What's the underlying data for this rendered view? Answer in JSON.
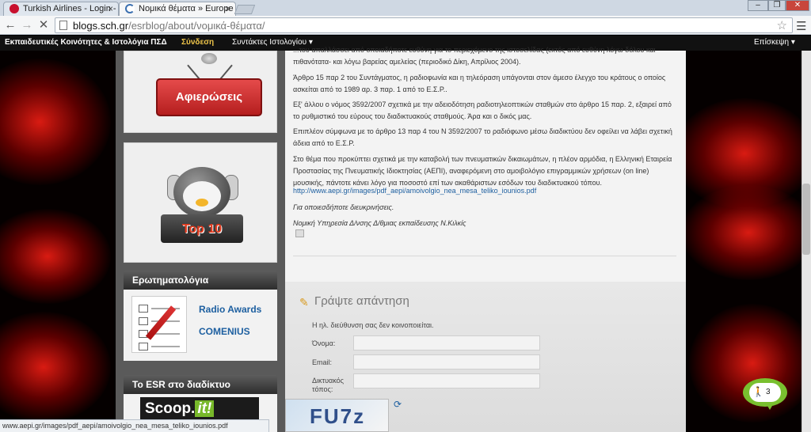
{
  "browser": {
    "tabs": [
      {
        "title": "Turkish Airlines - Login -",
        "close": "×"
      },
      {
        "title": "Νομικά θέματα » Europe",
        "close": "×"
      }
    ],
    "window_controls": {
      "minimize": "–",
      "restore": "❐",
      "close": "✕"
    },
    "nav": {
      "back": "←",
      "forward": "→",
      "stop": "✕"
    },
    "url": {
      "host": "blogs.sch.gr",
      "path": "/esrblog/about/νομικά-θέματα/"
    },
    "star": "☆",
    "menu": "☰",
    "status_url": "www.aepi.gr/images/pdf_aepi/amoivolgio_nea_mesa_teliko_iounios.pdf"
  },
  "site_bar": {
    "brand": "Εκπαιδευτικές Κοινότητες & Ιστολόγια ΠΣΔ",
    "login": "Σύνδεση",
    "authors": "Συντάκτες Ιστολογίου ▾",
    "visit": "Επίσκεψη ▾"
  },
  "sidebar": {
    "tributes_sign": "Αφιερώσεις",
    "top10_label": "Top 10",
    "quiz_title": "Ερωτηματολόγια",
    "radio_awards": "Radio Awards",
    "comenius": "COMENIUS",
    "esr_web_title": "Το ESR στο διαδίκτυο",
    "scoop_text": "Scoop.",
    "scoop_it": "it!"
  },
  "article": {
    "p0": "...του απαλλάσσει από οποιαδήποτε ευθύνη για το περιεχόμενο της ιστοσελίδας (εκτός από ευθύνη λόγω δόλου και πιθανότατα- και λόγω βαρείας αμελείας (περιοδικό Δίκη, Απρίλιος 2004).",
    "p1": "Άρθρο 15 παρ 2 του Συντάγματος, η ραδιοφωνία και η τηλεόραση υπάγονται στον άμεσο έλεγχο του κράτους ο οποίος ασκείται από το 1989 αρ. 3 παρ. 1 από το Ε.Σ.Ρ..",
    "p2": "Εξ' άλλου ο νόμος 3592/2007 σχετικά με την αδειοδότηση ραδιοτηλεοπτικών σταθμών στο άρθρο 15 παρ. 2, εξαιρεί από το ρυθμιστικό του εύρους του διαδικτυακούς σταθμούς. Άρα και ο δικός μας.",
    "p3": "Επιπλέον σύμφωνα με το άρθρο 13 παρ 4 του Ν 3592/2007 το ραδιόφωνο μέσω διαδικτύου δεν οφείλει να λάβει σχετική άδεια από το Ε.Σ.Ρ.",
    "p4": "Στο θέμα που προκύπτει σχετικά με την καταβολή των πνευματικών δικαιωμάτων, η πλέον αρμόδια, η Ελληνική Εταιρεία Προστασίας της Πνευματικής Ιδιοκτησίας (ΑΕΠΙ), αναφερόμενη στο αμοιβολόγιο επιγραμμικών χρήσεων (on line) μουσικής, πάντοτε κάνει λόγο για ποσοστό επί των ακαθάριστων εσόδων του διαδικτυακού τόπου.",
    "link": "http://www.aepi.gr/images/pdf_aepi/amoivolgio_nea_mesa_teliko_iounios.pdf",
    "contact": "Για οποιεσδήποτε διευκρινήσεις.",
    "signature": "Νομική Υπηρεσία Δ/νσης Δ/θμιας εκπαίδευσης Ν.Κιλκίς"
  },
  "reply": {
    "title": "Γράψτε απάντηση",
    "pencil": "✎",
    "note": "Η ηλ. διεύθυνση σας δεν κοινοποιείται.",
    "name_label": "Όνομα:",
    "email_label": "Email:",
    "website_label_1": "Δικτυακός",
    "website_label_2": "τόπος:",
    "captcha": "FU7z",
    "refresh": "⟳"
  },
  "chat": {
    "count": "3"
  },
  "colors": {
    "accent_login": "#f0c64a",
    "link": "#1d5fa0",
    "chat": "#79c02f"
  }
}
